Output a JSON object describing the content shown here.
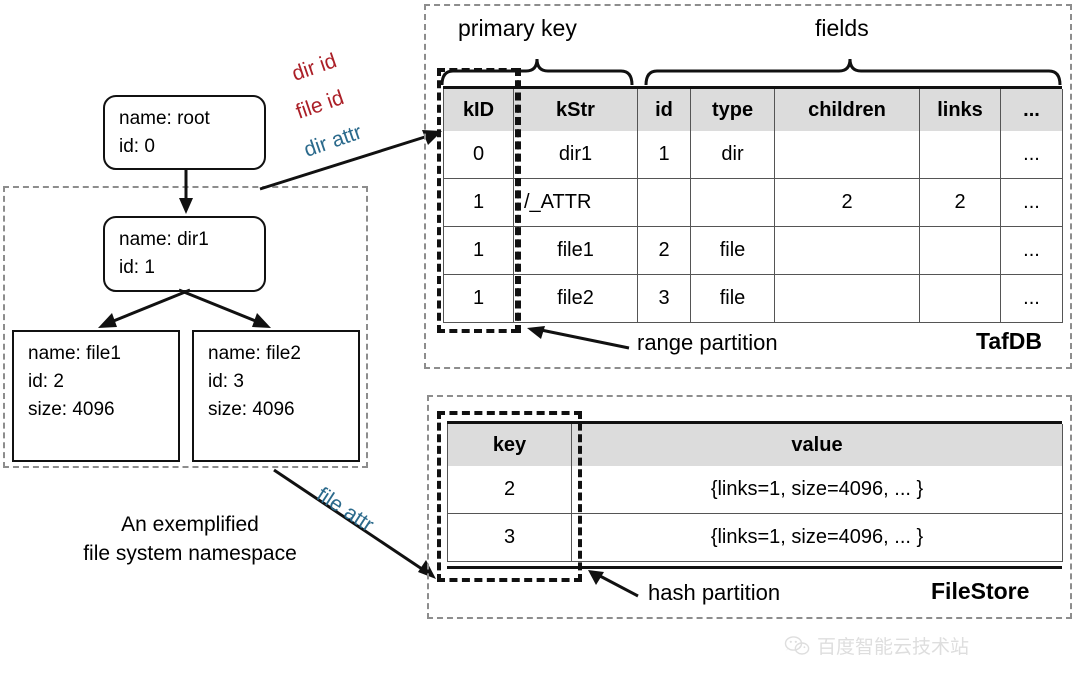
{
  "diagram": {
    "title_caption_line1": "An exemplified",
    "title_caption_line2": "file system namespace"
  },
  "tree": {
    "nodes": [
      {
        "name_line": "name: root",
        "id_line": "id: 0"
      },
      {
        "name_line": "name: dir1",
        "id_line": "id: 1"
      },
      {
        "name_line": "name: file1",
        "id_line": "id: 2",
        "size_line": "size: 4096"
      },
      {
        "name_line": "name: file2",
        "id_line": "id: 3",
        "size_line": "size: 4096"
      }
    ]
  },
  "edge_labels": {
    "dir_id": "dir id",
    "file_id": "file id",
    "dir_attr": "dir attr",
    "file_attr": "file attr"
  },
  "tafdb": {
    "store_name": "TafDB",
    "brace_primary_key": "primary key",
    "brace_fields": "fields",
    "partition_note": "range partition",
    "columns": [
      "kID",
      "kStr",
      "id",
      "type",
      "children",
      "links",
      "..."
    ],
    "rows": [
      {
        "color": "red",
        "cells": [
          "0",
          "dir1",
          "1",
          "dir",
          "",
          "",
          "..."
        ]
      },
      {
        "color": "blue",
        "cells": [
          "1",
          "/_ATTR",
          "",
          "",
          "2",
          "2",
          "..."
        ]
      },
      {
        "color": "red",
        "cells": [
          "1",
          "file1",
          "2",
          "file",
          "",
          "",
          "..."
        ]
      },
      {
        "color": "red",
        "cells": [
          "1",
          "file2",
          "3",
          "file",
          "",
          "",
          "..."
        ]
      }
    ]
  },
  "filestore": {
    "store_name": "FileStore",
    "partition_note": "hash partition",
    "columns": [
      "key",
      "value"
    ],
    "rows": [
      {
        "color": "blue",
        "cells": [
          "2",
          "{links=1, size=4096, ... }"
        ]
      },
      {
        "color": "blue",
        "cells": [
          "3",
          "{links=1, size=4096, ... }"
        ]
      }
    ]
  },
  "watermark": {
    "text": "百度智能云技术站",
    "icon": "wechat-icon"
  },
  "colors": {
    "red": "#ab1f27",
    "blue": "#2b6a8c",
    "header_bg": "#dcdcdc",
    "dash_gray": "#8d8d8d",
    "ink": "#111111"
  }
}
